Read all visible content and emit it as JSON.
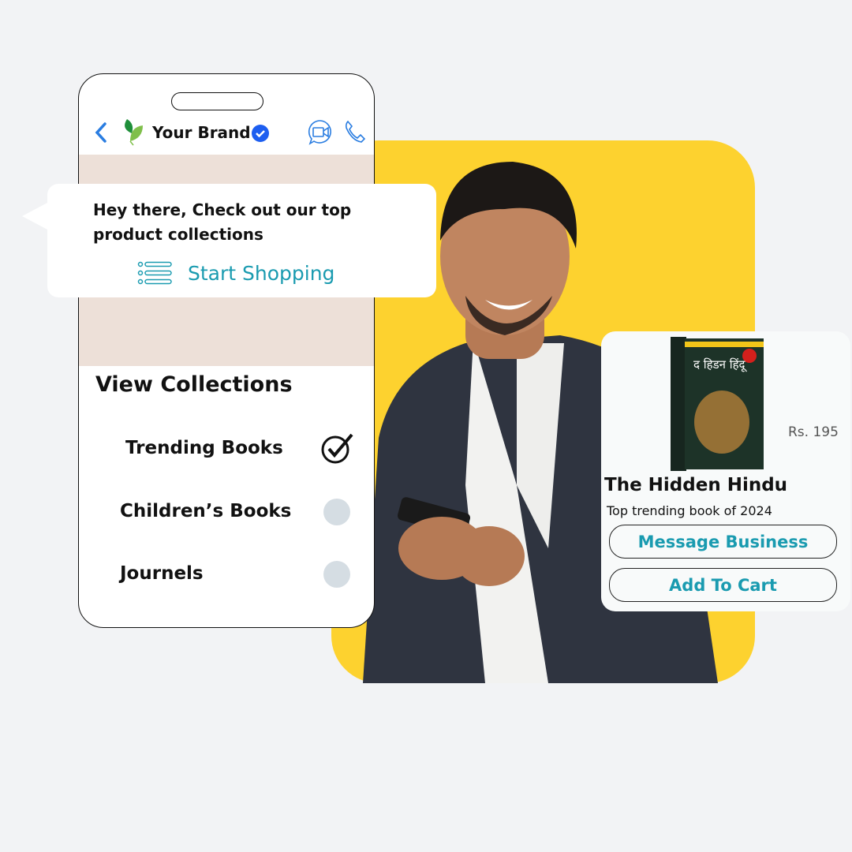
{
  "colors": {
    "background": "#f2f3f5",
    "accent_yellow": "#fdd22f",
    "teal": "#1a9bb0",
    "chat_band": "#ede0d8",
    "verified_blue": "#1d5ef0",
    "icon_blue": "#2a7de1"
  },
  "phone": {
    "header": {
      "brand_name": "Your Brand",
      "icons": [
        "back-chevron-icon",
        "leaf-logo-icon",
        "verified-badge-icon",
        "video-call-icon",
        "phone-call-icon"
      ]
    },
    "message": {
      "text": "Hey there, Check out our top product collections",
      "action_label": "Start Shopping",
      "action_icon": "list-icon"
    },
    "collections": {
      "title": "View Collections",
      "items": [
        {
          "label": "Trending Books",
          "selected": true
        },
        {
          "label": "Children’s Books",
          "selected": false
        },
        {
          "label": "Journels",
          "selected": false
        }
      ]
    }
  },
  "product": {
    "title": "The Hidden Hindu",
    "subtitle": "Top trending book of 2024",
    "price": "Rs. 195",
    "buttons": {
      "message": "Message Business",
      "cart": "Add To Cart"
    },
    "cover_text": "द हिडन हिंदू"
  }
}
